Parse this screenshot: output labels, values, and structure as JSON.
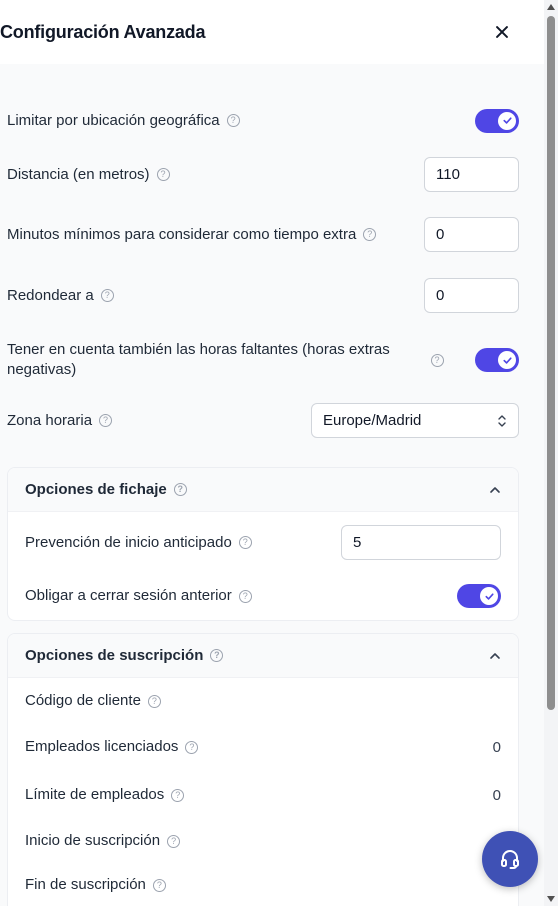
{
  "header": {
    "title": "Configuración Avanzada"
  },
  "settings": {
    "geo_limit": {
      "label": "Limitar por ubicación geográfica",
      "enabled": true
    },
    "distance": {
      "label": "Distancia (en metros)",
      "value": "110"
    },
    "min_minutes": {
      "label": "Minutos mínimos para considerar como tiempo extra",
      "value": "0"
    },
    "round_to": {
      "label": "Redondear a",
      "value": "0"
    },
    "missing_hours": {
      "label_line1": "Tener en cuenta también las horas faltantes (horas extras",
      "label_line2": "negativas)",
      "enabled": true
    },
    "timezone": {
      "label": "Zona horaria",
      "value": "Europe/Madrid"
    }
  },
  "clock_options": {
    "title": "Opciones de fichaje",
    "early_start": {
      "label": "Prevención de inicio anticipado",
      "value": "5"
    },
    "force_logout": {
      "label": "Obligar a cerrar sesión anterior",
      "enabled": true
    }
  },
  "subscription": {
    "title": "Opciones de suscripción",
    "rows": [
      {
        "label": "Código de cliente",
        "value": ""
      },
      {
        "label": "Empleados licenciados",
        "value": "0"
      },
      {
        "label": "Límite de empleados",
        "value": "0"
      },
      {
        "label": "Inicio de suscripción",
        "value": ""
      },
      {
        "label": "Fin de suscripción",
        "value": ""
      }
    ]
  },
  "icons": {
    "help": "?",
    "close": "close-icon",
    "check": "check-icon",
    "chevron": "chevron-up-icon",
    "select": "select-arrows-icon",
    "support": "headset-icon"
  },
  "colors": {
    "accent": "#4f46e5",
    "fab": "#3f51b5"
  }
}
